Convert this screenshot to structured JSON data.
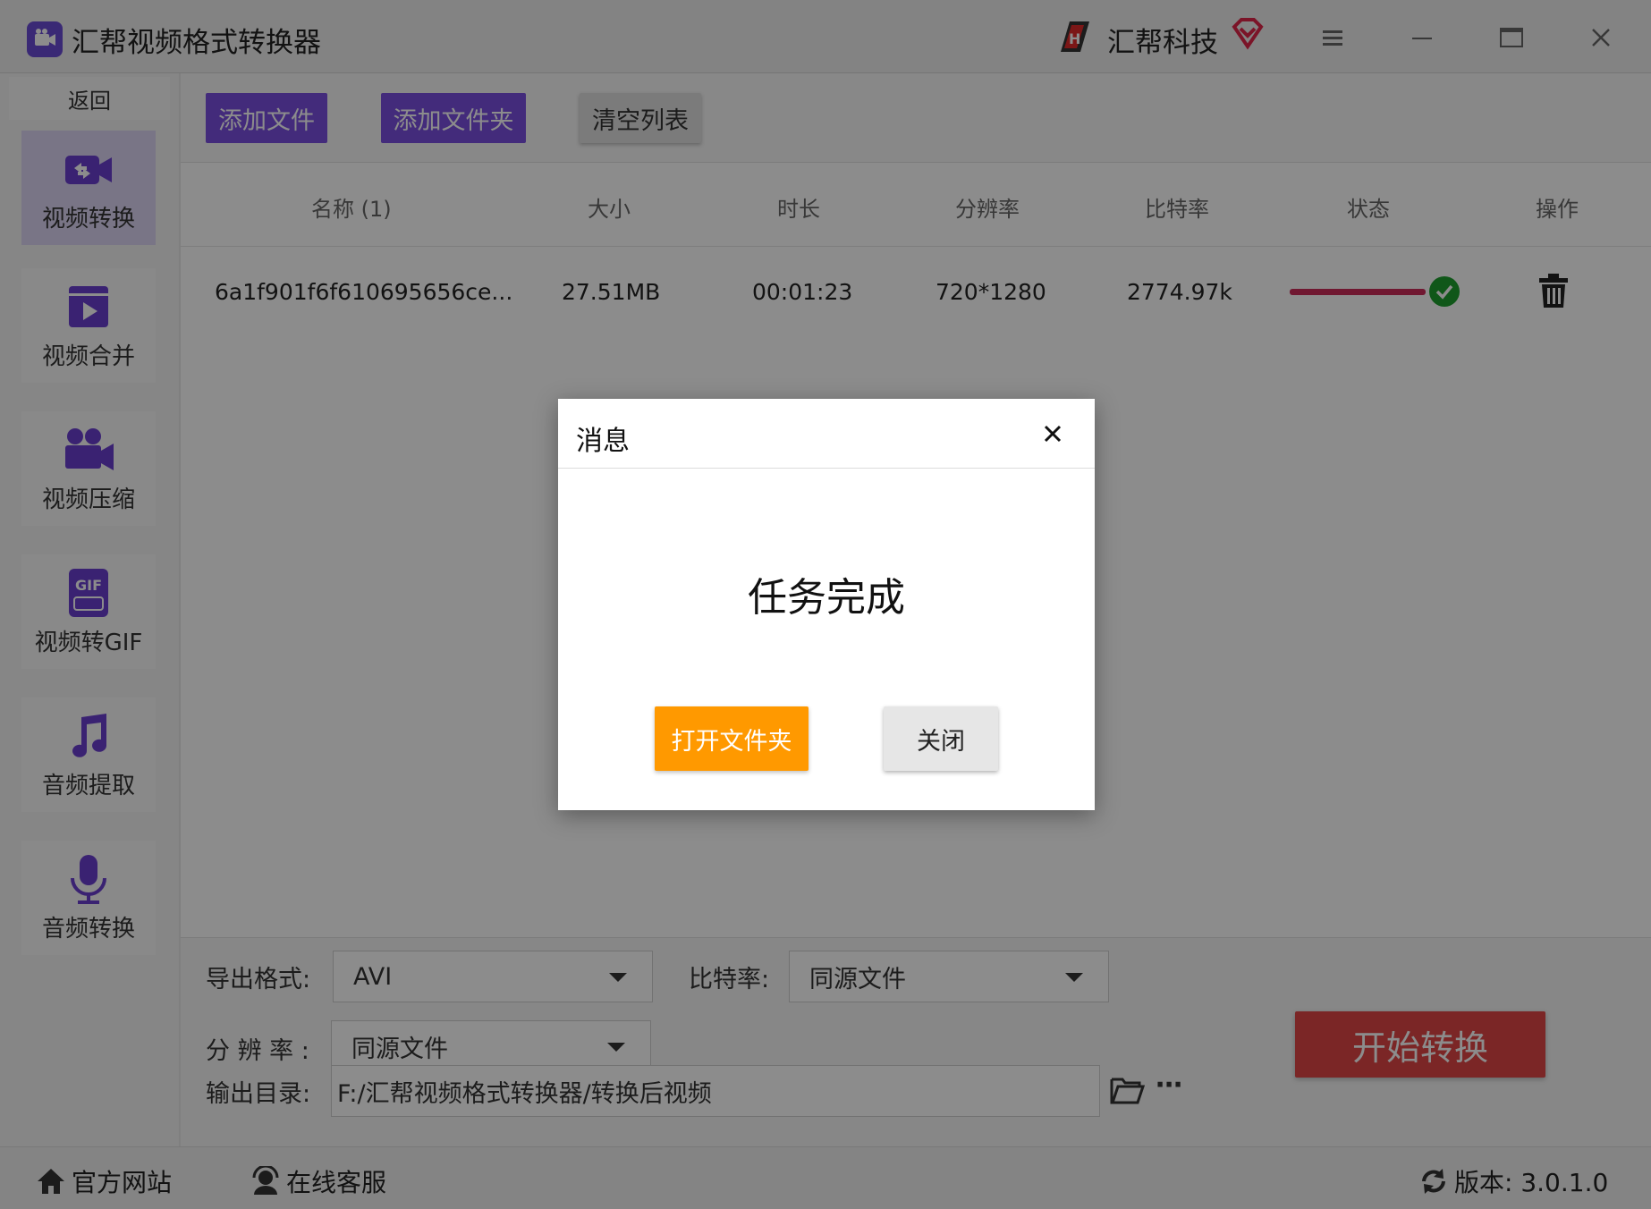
{
  "window": {
    "title": "汇帮视频格式转换器",
    "brand": "汇帮科技"
  },
  "sidebar": {
    "back_label": "返回",
    "items": [
      {
        "label": "视频转换",
        "icon": "video-convert-icon",
        "active": true
      },
      {
        "label": "视频合并",
        "icon": "video-merge-icon",
        "active": false
      },
      {
        "label": "视频压缩",
        "icon": "video-compress-icon",
        "active": false
      },
      {
        "label": "视频转GIF",
        "icon": "gif-icon",
        "active": false
      },
      {
        "label": "音频提取",
        "icon": "music-note-icon",
        "active": false
      },
      {
        "label": "音频转换",
        "icon": "microphone-icon",
        "active": false
      }
    ]
  },
  "toolbar": {
    "add_file": "添加文件",
    "add_folder": "添加文件夹",
    "clear_list": "清空列表"
  },
  "table": {
    "headers": [
      "名称 (1)",
      "大小",
      "时长",
      "分辨率",
      "比特率",
      "状态",
      "操作"
    ],
    "rows": [
      {
        "name": "6a1f901f6f610695656ce...",
        "size": "27.51MB",
        "duration": "00:01:23",
        "resolution": "720*1280",
        "bitrate": "2774.97k",
        "status_progress": 1.0,
        "status": "complete"
      }
    ]
  },
  "settings": {
    "format_label": "导出格式:",
    "format_value": "AVI",
    "bitrate_label": "比特率:",
    "bitrate_value": "同源文件",
    "resolution_label": "分 辨 率 :",
    "resolution_value": "同源文件",
    "output_label": "输出目录:",
    "output_path": "F:/汇帮视频格式转换器/转换后视频",
    "start_button": "开始转换"
  },
  "footer": {
    "website": "官方网站",
    "support": "在线客服",
    "version": "版本:  3.0.1.0"
  },
  "dialog": {
    "title": "消息",
    "message": "任务完成",
    "open_folder": "打开文件夹",
    "close": "关闭"
  },
  "colors": {
    "accent_purple": "#7b4fe0",
    "start_red": "#e04545",
    "dialog_orange": "#ff9900",
    "progress": "#cc2c5a",
    "success": "#1e9e2e"
  }
}
